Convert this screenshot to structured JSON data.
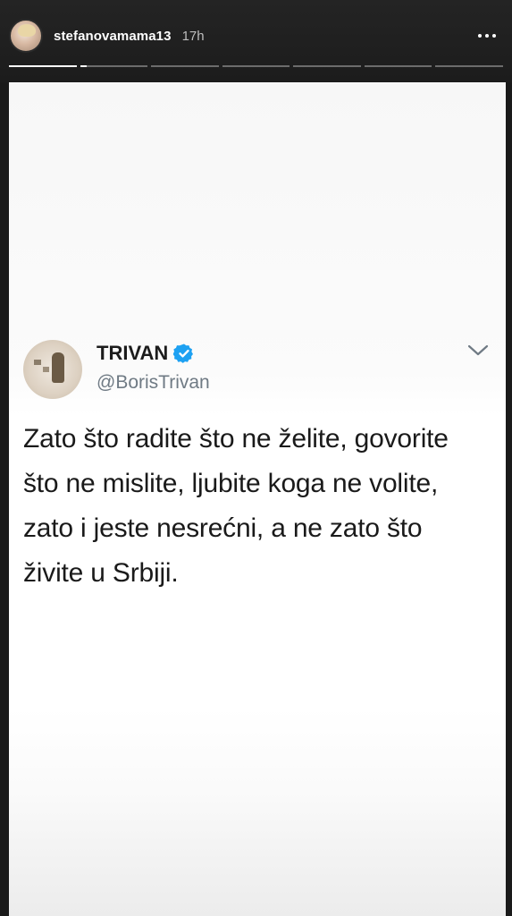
{
  "story": {
    "username": "stefanovamama13",
    "time": "17h",
    "more_icon": "more-horizontal-icon",
    "progress": [
      {
        "fill": 1.0
      },
      {
        "fill": 0.1
      },
      {
        "fill": 0
      },
      {
        "fill": 0
      },
      {
        "fill": 0
      },
      {
        "fill": 0
      },
      {
        "fill": 0
      }
    ]
  },
  "tweet": {
    "display_name": "TRIVAN",
    "verified_icon": "verified-badge-icon",
    "handle": "@BorisTrivan",
    "text": "Zato što radite što ne želite, govorite što ne mislite, ljubite koga ne volite, zato i jeste nesrećni, a ne zato što živite u Srbiji.",
    "menu_icon": "chevron-down-icon"
  },
  "colors": {
    "verified": "#1da1f2",
    "background": "#1a1a1a"
  }
}
